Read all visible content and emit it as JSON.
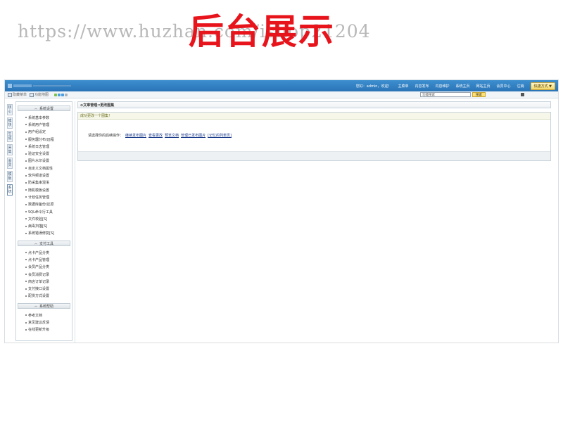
{
  "banner": {
    "title": "后台展示",
    "watermark": "https://www.huzhan.com/ishop21204"
  },
  "topbar": {
    "logo_text": "",
    "greeting": "您好：admin，欢迎！",
    "nav": [
      "主菜单",
      "内容发布",
      "内容维护",
      "系统主页",
      "网站主页",
      "会员中心",
      "注销"
    ],
    "quick_label": "快捷方式 ▼"
  },
  "toolbar": {
    "items": [
      "隐藏菜单",
      "功能地图"
    ],
    "dot_colors": [
      "#7cc24a",
      "#4a9ee0",
      "#4a9ee0",
      "#aab4be"
    ],
    "search_value": "功能搜索",
    "search_button": "搜索"
  },
  "vtabs": [
    "核心",
    "模块",
    "生成",
    "采集",
    "会员",
    "模板",
    "系统"
  ],
  "sidebar": {
    "groups": [
      {
        "title": "系统设置",
        "items": [
          "系统基本参数",
          "系统用户管理",
          "用户组设定",
          "服务器分布/远程",
          "系统日志管理",
          "验证安全设置",
          "图片水印设置",
          "自定义文档属性",
          "软件频道设置",
          "防采集串混淆",
          "随机模板设置",
          "计划任务管理",
          "数据库备份/还原",
          "SQL命令行工具",
          "文件校验[S]",
          "病毒扫描[S]",
          "系统错误修复[S]"
        ]
      },
      {
        "title": "支付工具",
        "items": [
          "点卡产品分类",
          "点卡产品管理",
          "会员产品分类",
          "会员消费记录",
          "商店订单记录",
          "支付接口设置",
          "配货方式设置"
        ]
      },
      {
        "title": "系统帮助",
        "items": [
          "参考文档",
          "意见建议反馈",
          "在线更新升级"
        ]
      }
    ]
  },
  "main": {
    "crumb": "⊙文章管理::更改图集",
    "panel_head": "成功更改一个图集！",
    "prompt": "请选择你的后续操作：",
    "links": [
      "继续发布图片",
      "查看更改",
      "预览文档",
      "管理已发布图片",
      "[记忆的列表页]"
    ]
  }
}
